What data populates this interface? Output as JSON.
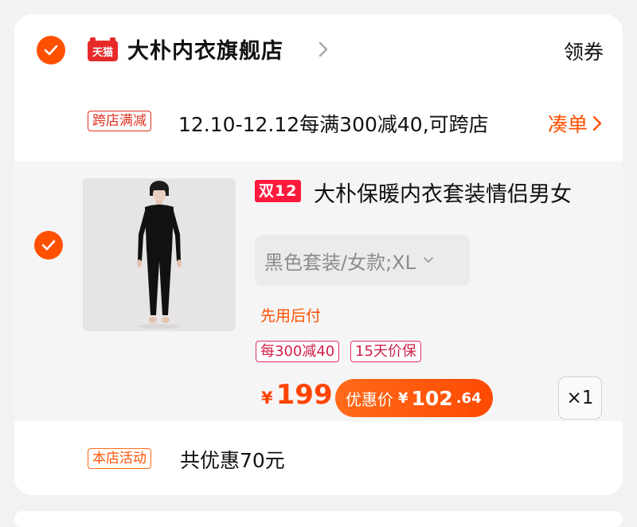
{
  "colors": {
    "accent": "#ff5000",
    "tag_red": "#e0301e",
    "badge_red": "#ff1a3d",
    "price_orange": "#ff4400"
  },
  "store": {
    "logo_text": "天猫",
    "name": "大朴内衣旗舰店",
    "chevron_icon": "chevron-right-icon",
    "coupon_label": "领券",
    "checked": true
  },
  "promo": {
    "tag": "跨店满减",
    "text": "12.10-12.12每满300减40,可跨店",
    "action": "凑单"
  },
  "item": {
    "checked": true,
    "image_icon": "product-photo-black-thermal-set",
    "badge": "双12",
    "title": "大朴保暖内衣套装情侣男女",
    "sku": "黑色套装/女款;XL",
    "pay_later": "先用后付",
    "tags": [
      "每300减40",
      "15天价保"
    ],
    "price_currency": "¥",
    "price": "199",
    "coupon_price_label": "优惠价",
    "coupon_price_currency": "¥",
    "coupon_price_int": "102",
    "coupon_price_dec": ".64",
    "quantity": "×1"
  },
  "activity": {
    "tag": "本店活动",
    "text": "共优惠70元"
  }
}
